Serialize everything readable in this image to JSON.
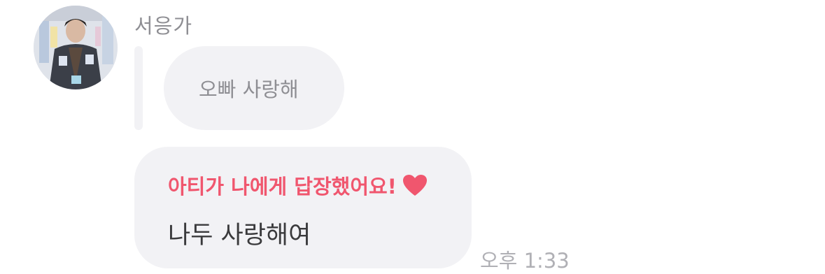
{
  "message": {
    "sender_name": "서응가",
    "avatar_icon": "profile-photo",
    "quoted_text": "오빠 사랑해",
    "reply_header": "아티가 나에게 답장했어요!",
    "reply_header_icon": "heart-icon",
    "reply_text": "나두 사랑해여",
    "timestamp": "오후 1:33"
  },
  "colors": {
    "accent": "#f0566e",
    "bubble": "#f2f2f5",
    "muted_text": "#8e8e93",
    "body_text": "#3a3a3c",
    "timestamp": "#b0b0b5"
  }
}
